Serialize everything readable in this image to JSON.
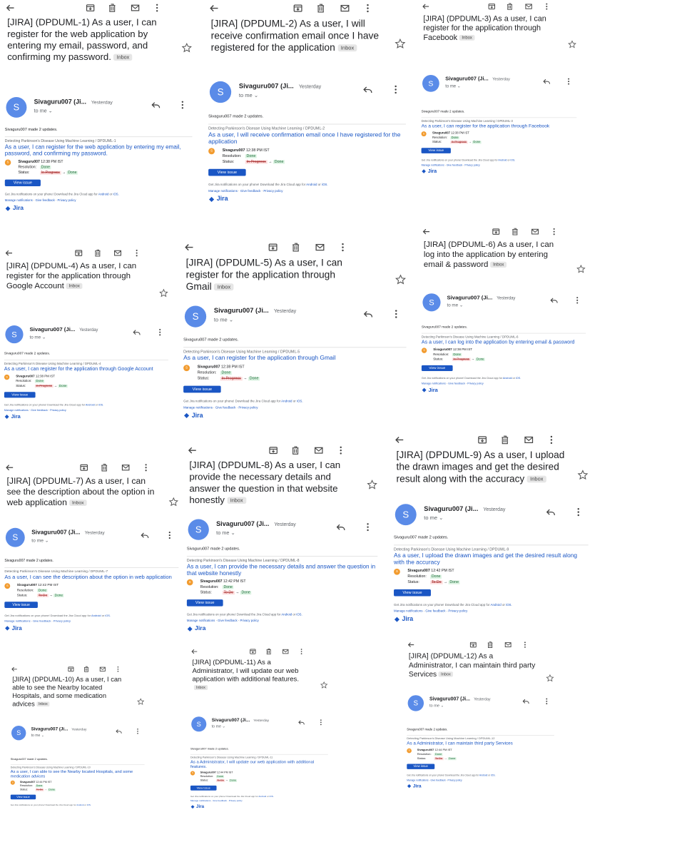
{
  "common": {
    "sender_name": "Sivaguru007 (Ji...",
    "sender_initial": "S",
    "time_label": "Yesterday",
    "to_me": "to me",
    "inbox_label": "Inbox",
    "made_updates": "Sivaguru007 made 2 updates.",
    "project_path": "Detecting Parkinson's Disease Using Machine Learning",
    "updater": "Sivaguru007",
    "resolution_label": "Resolution:",
    "resolution_value": "Done",
    "status_label": "Status:",
    "status_to": "Done",
    "view_issue": "View issue",
    "footer_prefix": "Get Jira notifications on your phone! Download the Jira Cloud app for",
    "footer_android": "Android",
    "footer_or": "or",
    "footer_ios": "iOS.",
    "manage_notifications": "Manage notifications",
    "give_feedback": "Give feedback",
    "privacy_policy": "Privacy policy",
    "jira_logo": "Jira"
  },
  "emails": [
    {
      "subject": "[JIRA] (DPDUML-1) As a user, I can register for the web application by entering my email, password, and confirming my password.",
      "key": "DPDUML-1",
      "issue_title": "As a user, I can register for the web application by entering my email, password, and confirming my password.",
      "time": "12:38 PM IST",
      "status_from": "In Progress"
    },
    {
      "subject": "[JIRA] (DPDUML-2) As a user, I will receive confirmation email once I have registered for the application",
      "key": "DPDUML-2",
      "issue_title": "As a user, I will receive confirmation email once I have registered for the application",
      "time": "12:38 PM IST",
      "status_from": "In Progress"
    },
    {
      "subject": "[JIRA] (DPDUML-3) As a user, I can register for the application through Facebook",
      "key": "DPDUML-3",
      "issue_title": "As a user, I can register for the application through Facebook",
      "time": "12:38 PM IST",
      "status_from": "In Progress"
    },
    {
      "subject": "[JIRA] (DPDUML-4) As a user, I can register for the application through Google Account",
      "key": "DPDUML-4",
      "issue_title": "As a user, I can register for the application through Google Account",
      "time": "12:38 PM IST",
      "status_from": "In Progress"
    },
    {
      "subject": "[JIRA] (DPDUML-5) As a user, I can register for the application through Gmail",
      "key": "DPDUML-5",
      "issue_title": "As a user, I can register for the application through Gmail",
      "time": "12:38 PM IST",
      "status_from": "In Progress"
    },
    {
      "subject": "[JIRA] (DPDUML-6) As a user, I can log into the application by entering email & password",
      "key": "DPDUML-6",
      "issue_title": "As a user, I can log into the application by entering email & password",
      "time": "12:38 PM IST",
      "status_from": "In Progress"
    },
    {
      "subject": "[JIRA] (DPDUML-7) As a user, I can see the description about the option in web application",
      "key": "DPDUML-7",
      "issue_title": "As a user, I can see the description about the option in web application",
      "time": "12:42 PM IST",
      "status_from": "To Do"
    },
    {
      "subject": "[JIRA] (DPDUML-8) As a user, I can provide the necessary details and answer the question in that website honestly",
      "key": "DPDUML-8",
      "issue_title": "As a user, I can provide the necessary details and answer the question in that website honestly",
      "time": "12:42 PM IST",
      "status_from": "To Do"
    },
    {
      "subject": "[JIRA] (DPDUML-9) As a user, I upload the drawn images and get the desired result along with the accuracy",
      "key": "DPDUML-9",
      "issue_title": "As a user, I upload the drawn images and get the desired result along with the accuracy",
      "time": "12:42 PM IST",
      "status_from": "To Do"
    },
    {
      "subject": "[JIRA] (DPDUML-10) As a user, I can able to see the Nearby located Hospitals, and some medication advices",
      "key": "DPDUML-10",
      "issue_title": "As a user, I can able to see the Nearby located Hospitals, and some medication advices",
      "time": "12:44 PM IST",
      "status_from": "To Do"
    },
    {
      "subject": "[JIRA] (DPDUML-11) As a Administrator, I will update our web application with additional features.",
      "key": "DPDUML-11",
      "issue_title": "As a Administrator, I will update our web application with additional features.",
      "time": "12:44 PM IST",
      "status_from": "To Do"
    },
    {
      "subject": "[JIRA] (DPDUML-12) As a Administrator, I can maintain third party Services",
      "key": "DPDUML-12",
      "issue_title": "As a Administrator, I can maintain third party Services",
      "time": "12:44 PM IST",
      "status_from": "To Do"
    }
  ]
}
